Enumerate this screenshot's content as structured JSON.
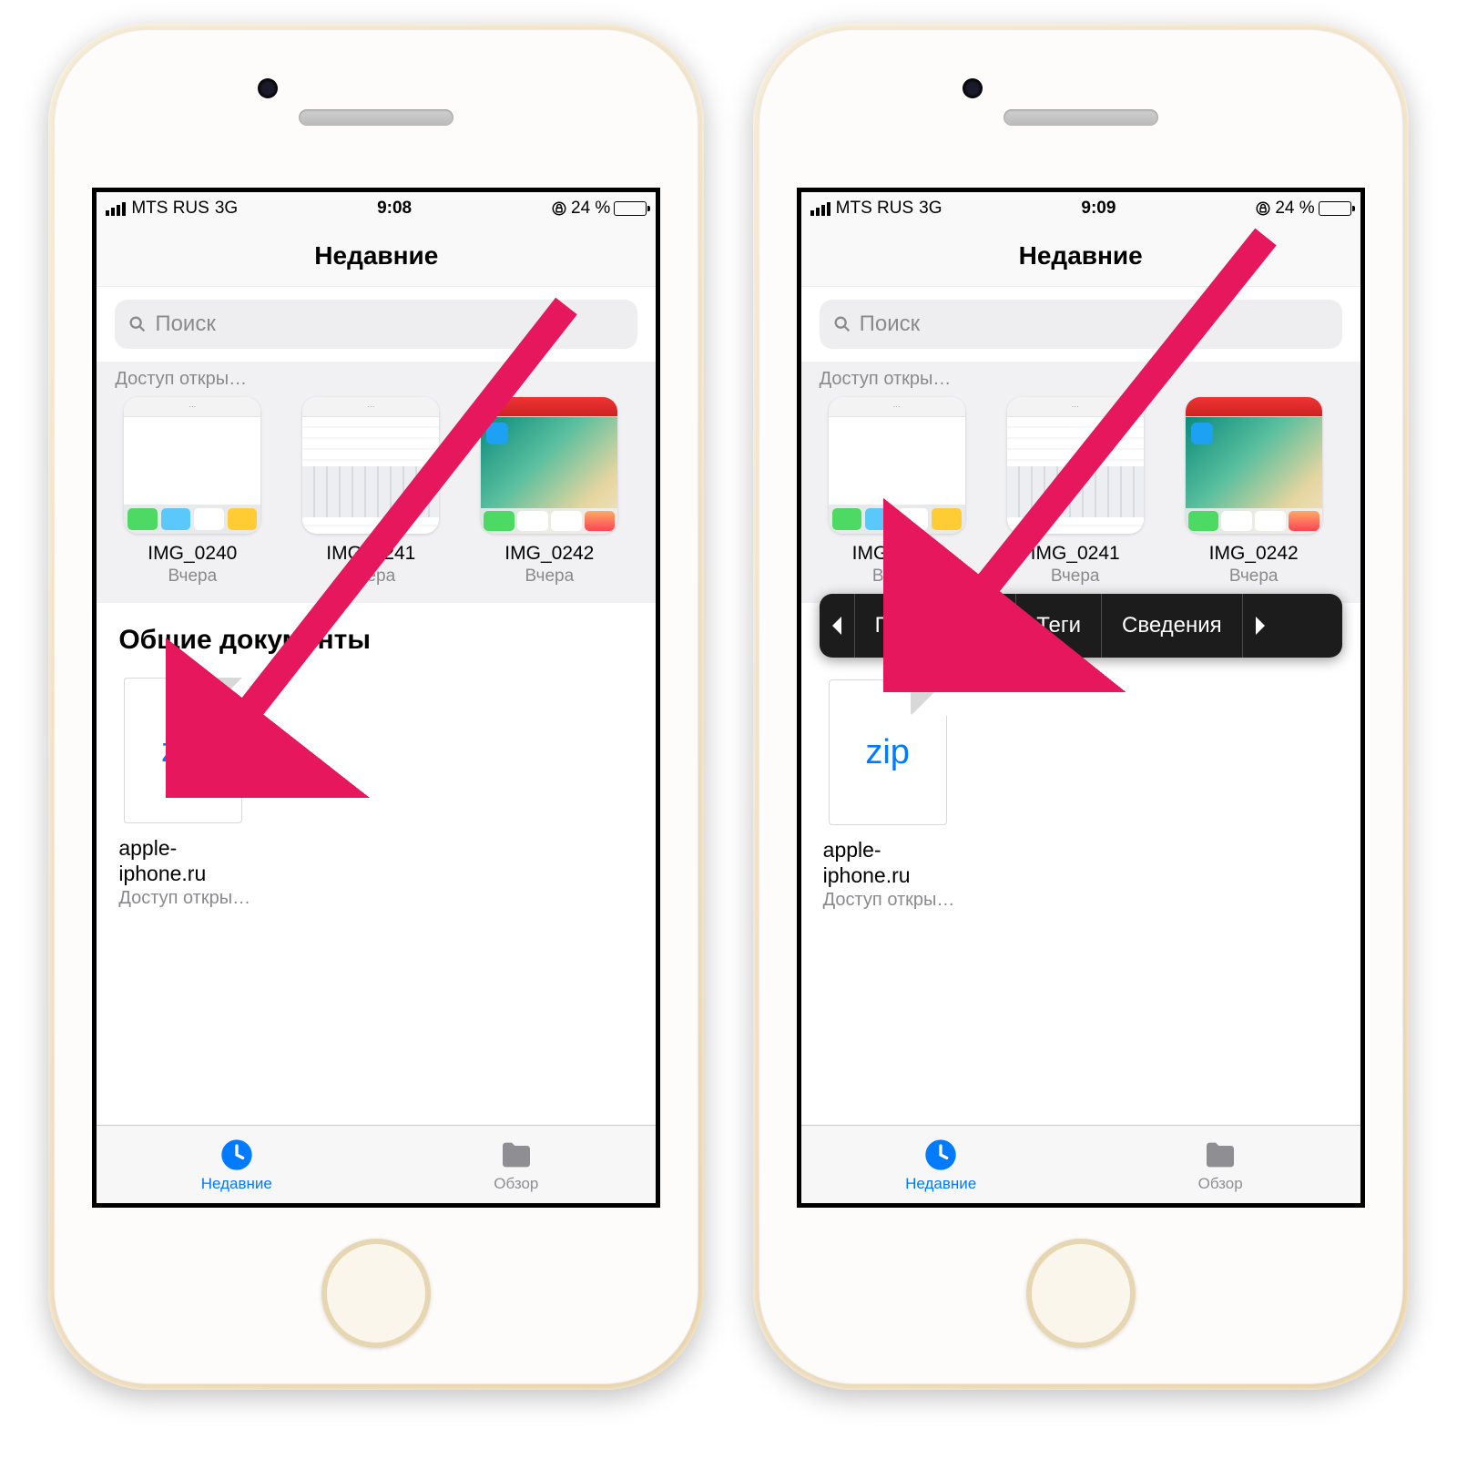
{
  "statusbar": {
    "carrier": "MTS RUS",
    "network": "3G",
    "battery_pct": "24 %"
  },
  "nav_title": "Недавние",
  "search": {
    "placeholder": "Поиск"
  },
  "shared_label": "Доступ откры…",
  "recent_thumbs": [
    {
      "name": "IMG_0240",
      "date": "Вчера"
    },
    {
      "name": "IMG_0241",
      "date": "Вчера"
    },
    {
      "name": "IMG_0242",
      "date": "Вчера"
    }
  ],
  "section_title": "Общие документы",
  "file": {
    "ext": "zip",
    "name_line1": "apple-",
    "name_line2": "iphone.ru",
    "sub": "Доступ откры…"
  },
  "tabs": {
    "recent": "Недавние",
    "browse": "Обзор"
  },
  "context_menu": {
    "share": "Поделиться",
    "tags": "Теги",
    "info": "Сведения"
  },
  "screens": [
    {
      "time": "9:08",
      "show_context": false
    },
    {
      "time": "9:09",
      "show_context": true
    }
  ]
}
